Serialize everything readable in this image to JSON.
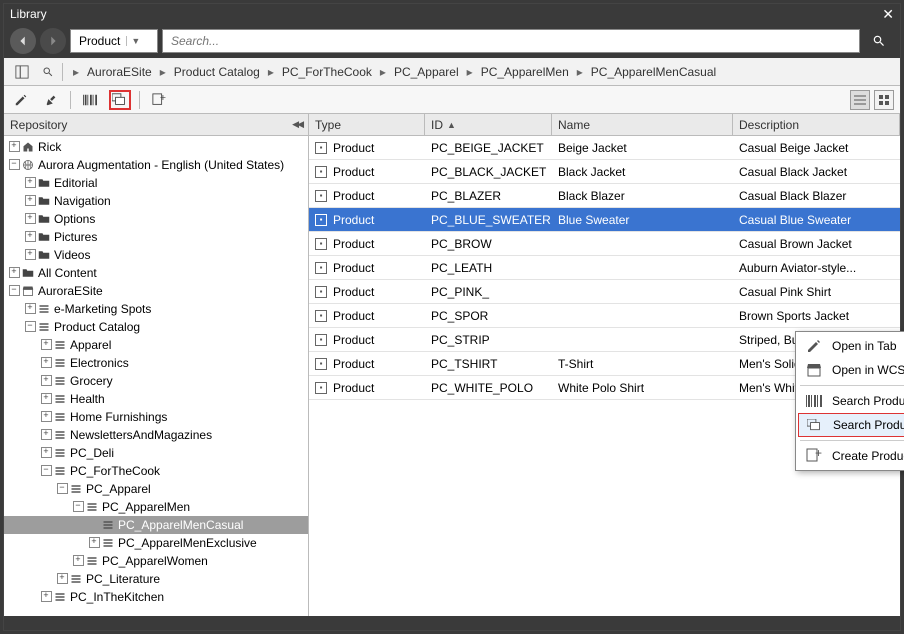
{
  "window": {
    "title": "Library"
  },
  "address": {
    "value": "Product"
  },
  "search": {
    "placeholder": "Search..."
  },
  "breadcrumbs": [
    "AuroraESite",
    "Product Catalog",
    "PC_ForTheCook",
    "PC_Apparel",
    "PC_ApparelMen",
    "PC_ApparelMenCasual"
  ],
  "sidebar": {
    "header": "Repository"
  },
  "tree": [
    {
      "d": 0,
      "t": "plus",
      "ic": "home",
      "label": "Rick"
    },
    {
      "d": 0,
      "t": "minus",
      "ic": "globe",
      "label": "Aurora Augmentation - English (United States)"
    },
    {
      "d": 1,
      "t": "plus",
      "ic": "folder",
      "label": "Editorial"
    },
    {
      "d": 1,
      "t": "plus",
      "ic": "folder",
      "label": "Navigation"
    },
    {
      "d": 1,
      "t": "plus",
      "ic": "folder",
      "label": "Options"
    },
    {
      "d": 1,
      "t": "plus",
      "ic": "folder",
      "label": "Pictures"
    },
    {
      "d": 1,
      "t": "plus",
      "ic": "folder",
      "label": "Videos"
    },
    {
      "d": 0,
      "t": "plus",
      "ic": "folder",
      "label": "All Content"
    },
    {
      "d": 0,
      "t": "minus",
      "ic": "store",
      "label": "AuroraESite"
    },
    {
      "d": 1,
      "t": "plus",
      "ic": "list",
      "label": "e-Marketing Spots"
    },
    {
      "d": 1,
      "t": "minus",
      "ic": "list",
      "label": "Product Catalog"
    },
    {
      "d": 2,
      "t": "plus",
      "ic": "list",
      "label": "Apparel"
    },
    {
      "d": 2,
      "t": "plus",
      "ic": "list",
      "label": "Electronics"
    },
    {
      "d": 2,
      "t": "plus",
      "ic": "list",
      "label": "Grocery"
    },
    {
      "d": 2,
      "t": "plus",
      "ic": "list",
      "label": "Health"
    },
    {
      "d": 2,
      "t": "plus",
      "ic": "list",
      "label": "Home Furnishings"
    },
    {
      "d": 2,
      "t": "plus",
      "ic": "list",
      "label": "NewslettersAndMagazines"
    },
    {
      "d": 2,
      "t": "plus",
      "ic": "list",
      "label": "PC_Deli"
    },
    {
      "d": 2,
      "t": "minus",
      "ic": "list",
      "label": "PC_ForTheCook"
    },
    {
      "d": 3,
      "t": "minus",
      "ic": "list",
      "label": "PC_Apparel"
    },
    {
      "d": 4,
      "t": "minus",
      "ic": "list",
      "label": "PC_ApparelMen"
    },
    {
      "d": 5,
      "t": "none",
      "ic": "list",
      "label": "PC_ApparelMenCasual",
      "sel": true
    },
    {
      "d": 5,
      "t": "plus",
      "ic": "list",
      "label": "PC_ApparelMenExclusive"
    },
    {
      "d": 4,
      "t": "plus",
      "ic": "list",
      "label": "PC_ApparelWomen"
    },
    {
      "d": 3,
      "t": "plus",
      "ic": "list",
      "label": "PC_Literature"
    },
    {
      "d": 2,
      "t": "plus",
      "ic": "list",
      "label": "PC_InTheKitchen"
    }
  ],
  "table": {
    "headers": {
      "type": "Type",
      "id": "ID",
      "name": "Name",
      "desc": "Description"
    },
    "rows": [
      {
        "type": "Product",
        "id": "PC_BEIGE_JACKET",
        "name": "Beige Jacket",
        "desc": "Casual Beige Jacket"
      },
      {
        "type": "Product",
        "id": "PC_BLACK_JACKET",
        "name": "Black Jacket",
        "desc": "Casual Black Jacket"
      },
      {
        "type": "Product",
        "id": "PC_BLAZER",
        "name": "Black Blazer",
        "desc": "Casual Black Blazer"
      },
      {
        "type": "Product",
        "id": "PC_BLUE_SWEATER",
        "name": "Blue Sweater",
        "desc": "Casual Blue Sweater",
        "sel": true
      },
      {
        "type": "Product",
        "id": "PC_BROW",
        "name": "",
        "desc": "Casual Brown Jacket"
      },
      {
        "type": "Product",
        "id": "PC_LEATH",
        "name": "",
        "desc": "Auburn Aviator-style..."
      },
      {
        "type": "Product",
        "id": "PC_PINK_",
        "name": "",
        "desc": "Casual Pink Shirt"
      },
      {
        "type": "Product",
        "id": "PC_SPOR",
        "name": "",
        "desc": "Brown Sports Jacket"
      },
      {
        "type": "Product",
        "id": "PC_STRIP",
        "name": "",
        "desc": "Striped, Buttoned V-..."
      },
      {
        "type": "Product",
        "id": "PC_TSHIRT",
        "name": "T-Shirt",
        "desc": "Men's Solid Color T-..."
      },
      {
        "type": "Product",
        "id": "PC_WHITE_POLO",
        "name": "White Polo Shirt",
        "desc": "Men's White Cotton ..."
      }
    ]
  },
  "context_menu": {
    "items": [
      {
        "ic": "pencil",
        "label": "Open in Tab"
      },
      {
        "ic": "store",
        "label": "Open in WCS Management"
      },
      {
        "sep": true
      },
      {
        "ic": "barcode",
        "label": "Search Product Variants"
      },
      {
        "ic": "pictures",
        "label": "Search Product Pictures",
        "hl": true
      },
      {
        "sep": true
      },
      {
        "ic": "teaser",
        "label": "Create Product Teaser"
      }
    ]
  }
}
